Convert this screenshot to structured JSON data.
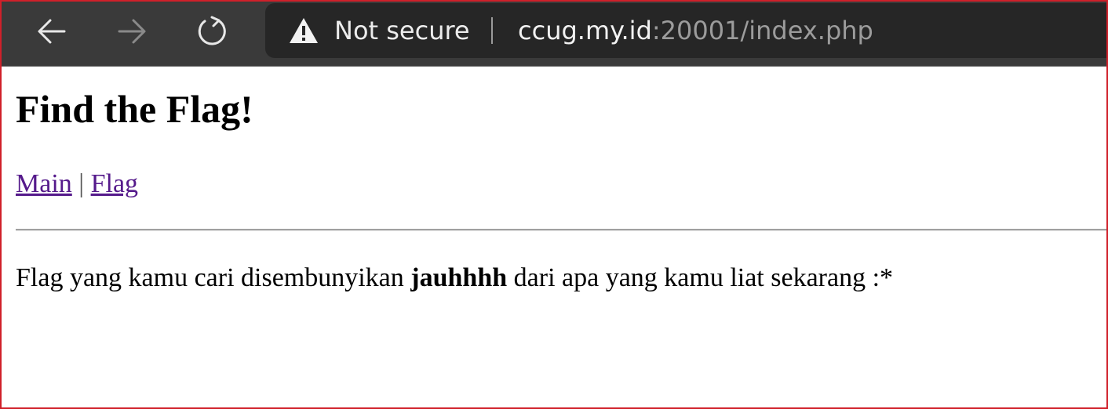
{
  "browser": {
    "security_label": "Not secure",
    "url_host": "ccug.my.id",
    "url_path": ":20001/index.php",
    "icons": [
      "back-arrow-icon",
      "forward-arrow-icon",
      "reload-icon",
      "warning-icon"
    ]
  },
  "page": {
    "title": "Find the Flag!",
    "nav": {
      "main_label": "Main",
      "separator": "|",
      "flag_label": "Flag"
    },
    "message": {
      "before": "Flag yang kamu cari disembunyikan ",
      "bold": "jauhhhh",
      "after": " dari apa yang kamu liat sekarang :*"
    }
  },
  "colors": {
    "toolbar_bg": "#3a3a3a",
    "omnibox_bg": "#262626",
    "visited_link": "#551a8b",
    "frame_border": "#d0202a"
  }
}
